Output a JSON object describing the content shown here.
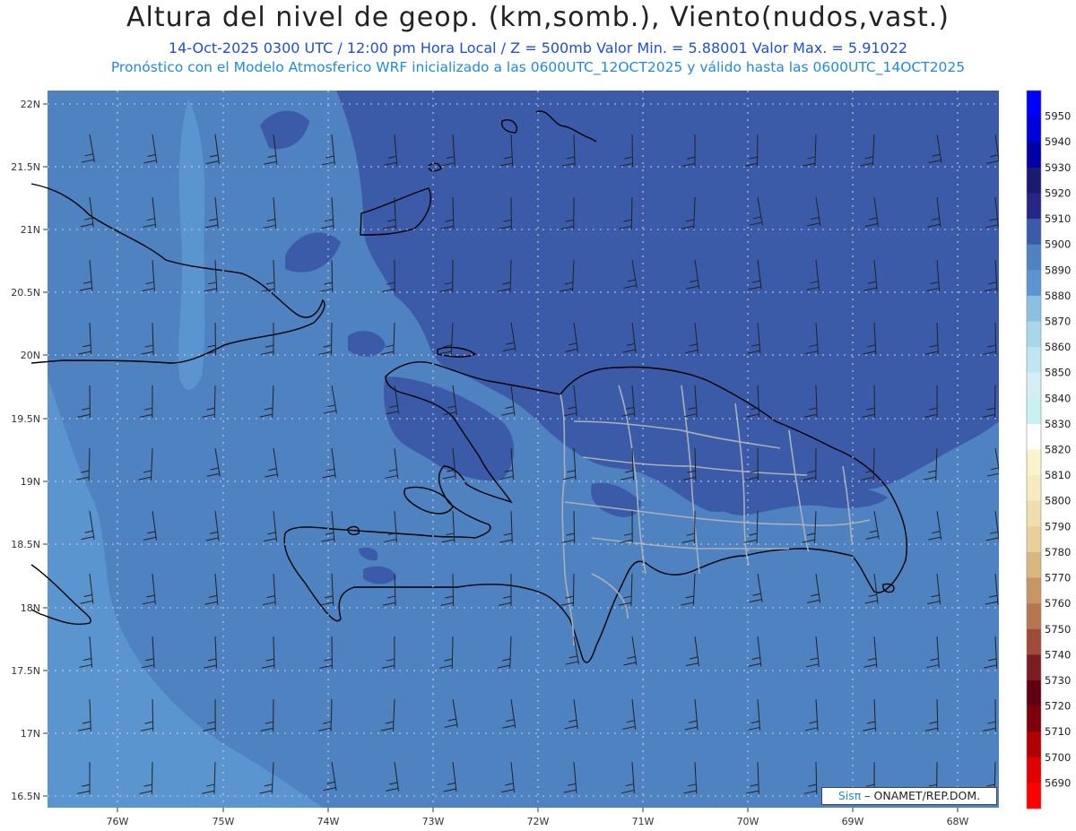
{
  "header": {
    "title": "Altura del nivel de geop. (km,somb.), Viento(nudos,vast.)",
    "subtitle": "14-Oct-2025  0300 UTC / 12:00 pm Hora Local / Z = 500mb     Valor Min. = 5.88001   Valor Max. = 5.91022",
    "model_line": "Pronóstico con el Modelo Atmosferico WRF inicializado a las 0600UTC_12OCT2025 y válido hasta las  0600UTC_14OCT2025"
  },
  "map": {
    "lat_ticks": [
      "22N",
      "21.5N",
      "21N",
      "20.5N",
      "20N",
      "19.5N",
      "19N",
      "18.5N",
      "18N",
      "17.5N",
      "17N",
      "16.5N"
    ],
    "lon_ticks": [
      "76W",
      "75W",
      "74W",
      "73W",
      "72W",
      "71W",
      "70W",
      "69W",
      "68W"
    ],
    "field_colors": {
      "5880": "#5b95cf",
      "5890": "#4f82c0",
      "5900": "#3b5ba8"
    }
  },
  "colorbar": {
    "levels": [
      {
        "label": "5950",
        "color": "#0000ff"
      },
      {
        "label": "5940",
        "color": "#0000d8"
      },
      {
        "label": "5930",
        "color": "#0000a6"
      },
      {
        "label": "5920",
        "color": "#1a1a70"
      },
      {
        "label": "5910",
        "color": "#262688"
      },
      {
        "label": "5900",
        "color": "#3b5ba8"
      },
      {
        "label": "5890",
        "color": "#4f82c0"
      },
      {
        "label": "5880",
        "color": "#5b95cf"
      },
      {
        "label": "5870",
        "color": "#8cc0e0"
      },
      {
        "label": "5860",
        "color": "#a9d7ea"
      },
      {
        "label": "5850",
        "color": "#c2e6f1"
      },
      {
        "label": "5840",
        "color": "#d5eef6"
      },
      {
        "label": "5830",
        "color": "#c8f1f3"
      },
      {
        "label": "5820",
        "color": "#ffffff"
      },
      {
        "label": "5810",
        "color": "#fbf3cc"
      },
      {
        "label": "5800",
        "color": "#f6ebc0"
      },
      {
        "label": "5790",
        "color": "#f0dfae"
      },
      {
        "label": "5780",
        "color": "#e8d09a"
      },
      {
        "label": "5770",
        "color": "#d9b57f"
      },
      {
        "label": "5760",
        "color": "#c99565"
      },
      {
        "label": "5750",
        "color": "#b57750"
      },
      {
        "label": "5740",
        "color": "#a04a3c"
      },
      {
        "label": "5730",
        "color": "#7b1e24"
      },
      {
        "label": "5720",
        "color": "#620012"
      },
      {
        "label": "5710",
        "color": "#7e000a"
      },
      {
        "label": "5700",
        "color": "#b00000"
      },
      {
        "label": "5690",
        "color": "#e00000"
      },
      {
        "label": "",
        "color": "#ff0000"
      }
    ]
  },
  "credit": {
    "brand": "Sisπ",
    "text": "– ONAMET/REP.DOM."
  }
}
